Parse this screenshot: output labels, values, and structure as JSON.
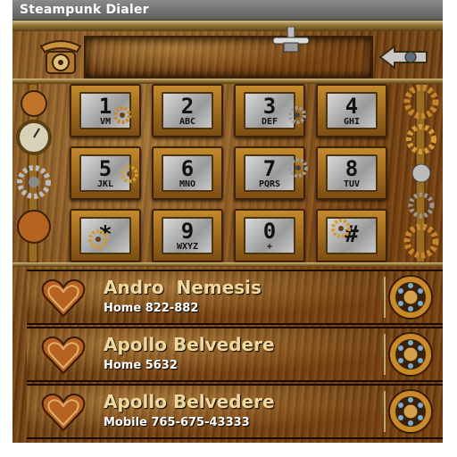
{
  "titlebar": {
    "title": "Steampunk Dialer"
  },
  "display": {
    "number": ""
  },
  "keys": [
    {
      "digit": "1",
      "letters": "VM"
    },
    {
      "digit": "2",
      "letters": "ABC"
    },
    {
      "digit": "3",
      "letters": "DEF"
    },
    {
      "digit": "4",
      "letters": "GHI"
    },
    {
      "digit": "5",
      "letters": "JKL"
    },
    {
      "digit": "6",
      "letters": "MNO"
    },
    {
      "digit": "7",
      "letters": "PQRS"
    },
    {
      "digit": "8",
      "letters": "TUV"
    },
    {
      "digit": "*",
      "letters": ""
    },
    {
      "digit": "9",
      "letters": "WXYZ"
    },
    {
      "digit": "0",
      "letters": "+"
    },
    {
      "digit": "#",
      "letters": ""
    }
  ],
  "contacts": [
    {
      "name": "Andro  Nemesis",
      "type": "Home",
      "number": "822-882"
    },
    {
      "name": "Apollo Belvedere",
      "type": "Home",
      "number": "5632"
    },
    {
      "name": "Apollo Belvedere",
      "type": "Mobile",
      "number": "765-675-43333"
    }
  ],
  "icons": {
    "phone": "rotary-phone-icon",
    "backspace": "backspace-arrow-icon",
    "contact": "heart-icon",
    "dial": "rotary-dial-icon"
  }
}
